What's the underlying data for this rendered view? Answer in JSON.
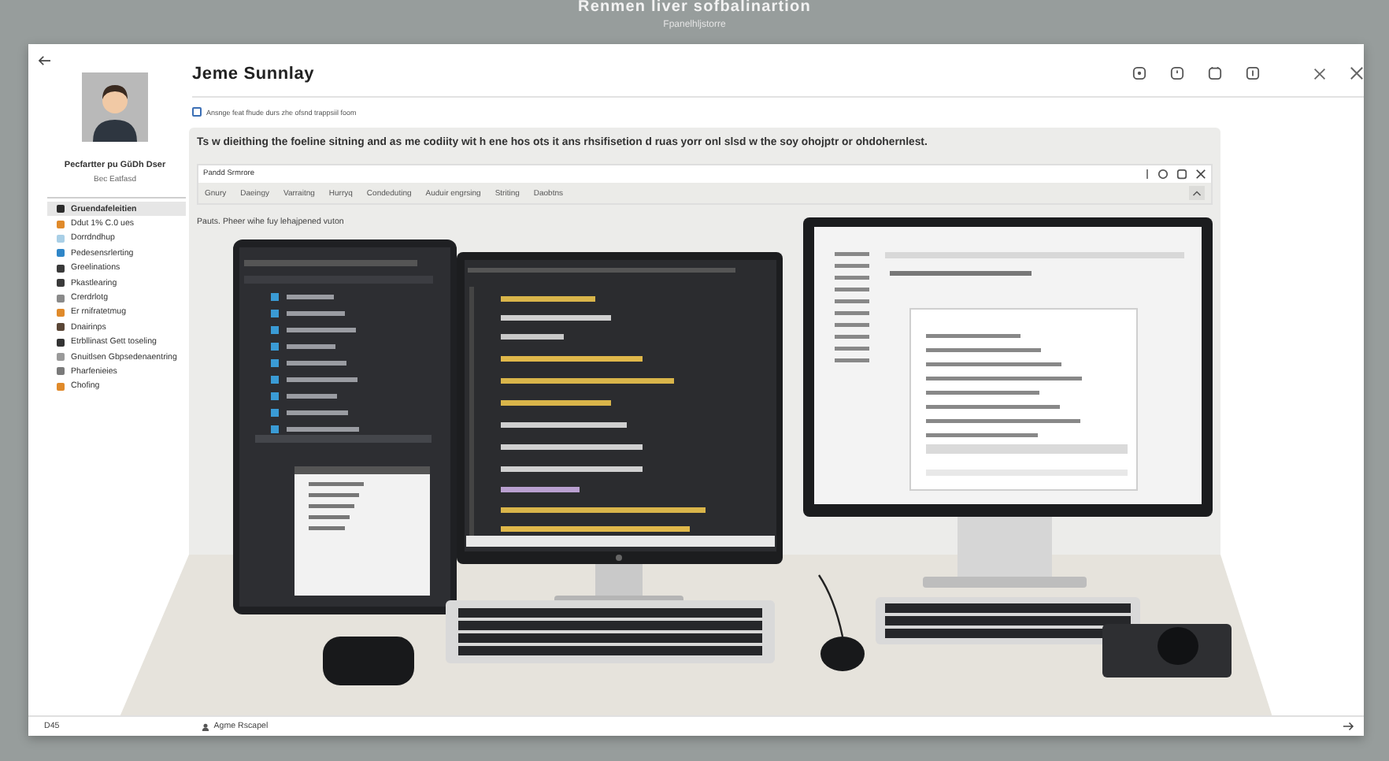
{
  "header": {
    "title": "Renmen liver sofbalinartion",
    "subtitle": "Fpanelhljstorre"
  },
  "profile": {
    "name": "Pecfartter pu GŭDh Dser",
    "subtitle": "Bec Eatfasd"
  },
  "sidebar": {
    "items": [
      {
        "label": "Gruendafeleitien",
        "selected": true,
        "color": "#2b2b2b"
      },
      {
        "label": "Ddut 1% C.0 ues",
        "selected": false,
        "color": "#e08a2a"
      },
      {
        "label": "Dorrdndhup",
        "selected": false,
        "color": "#a9cfe6"
      },
      {
        "label": "Pedesensrlerting",
        "selected": false,
        "color": "#2f86c8"
      },
      {
        "label": "Greelinations",
        "selected": false,
        "color": "#3a3a3a"
      },
      {
        "label": "Pkastlearing",
        "selected": false,
        "color": "#3a3a3a"
      },
      {
        "label": "Crerdrlotg",
        "selected": false,
        "color": "#8a8a8a"
      },
      {
        "label": "Er rnifratetmug",
        "selected": false,
        "color": "#e08a2a"
      },
      {
        "label": "Dnairinps",
        "selected": false,
        "color": "#5a4636"
      },
      {
        "label": "Etrbllinast Gett toseling",
        "selected": false,
        "color": "#333333"
      },
      {
        "label": "Gnuitlsen Gbpsedenaentring",
        "selected": false,
        "color": "#9a9a9a"
      },
      {
        "label": "Pharfenieies",
        "selected": false,
        "color": "#7a7a7a"
      },
      {
        "label": "Chofing",
        "selected": false,
        "color": "#e08a2a"
      }
    ]
  },
  "page": {
    "title": "Jeme Sunnlay",
    "option": {
      "label": "Ansnge feat fhude durs zhe ofsnd trappsiil foom",
      "checked": false
    }
  },
  "banner": "Ts w dieithing the foeline sitning and as me codiity wit h ene hos ots it ans rhsifisetion d ruas yorr onl slsd w the soy ohojptr or ohdohernlest.",
  "inner_window": {
    "title": "Pandd Srmrore",
    "menu_items": [
      "Gnury",
      "Daeingy",
      "Varraitng",
      "Hurryq",
      "Condeduting",
      "Auduir engrsing",
      "Striting",
      "Daobtns"
    ]
  },
  "caption": "Pauts. Pheer wihe fuy lehajpened vuton",
  "status_bar": {
    "left": "D45",
    "center": "Agme Rscapel"
  }
}
